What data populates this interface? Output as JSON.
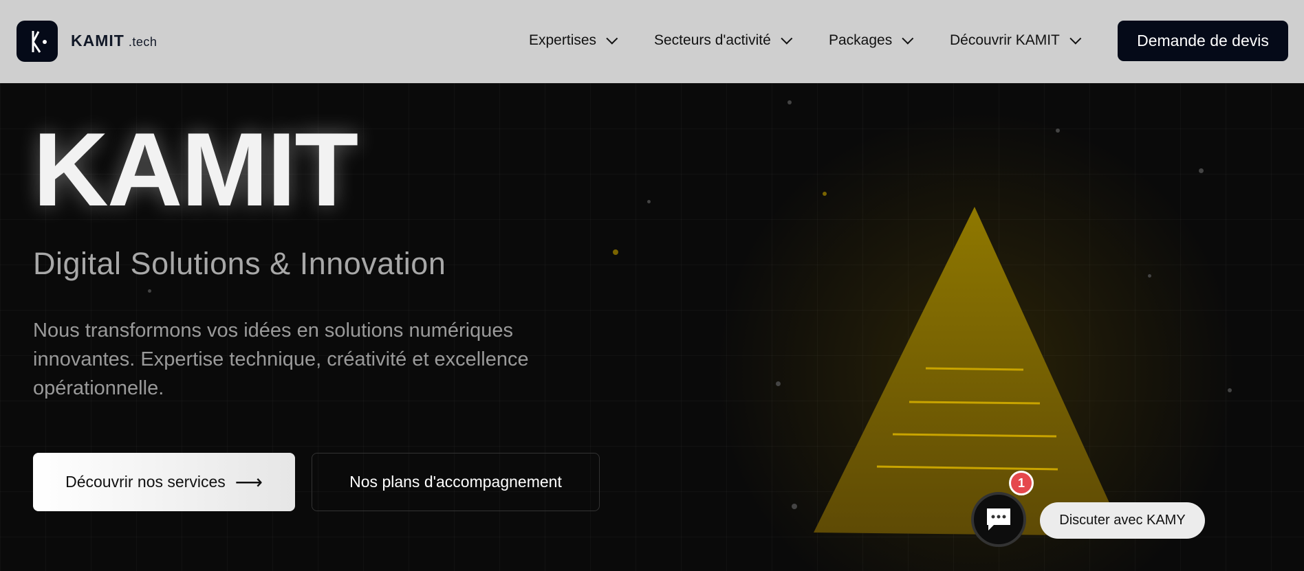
{
  "nav": {
    "brand": "KAMIT",
    "brand_suffix": ".tech",
    "items": [
      "Expertises",
      "Secteurs d'activité",
      "Packages",
      "Découvrir KAMIT"
    ],
    "cta": "Demande de devis"
  },
  "hero": {
    "title": "KAMIT",
    "subtitle": "Digital Solutions & Innovation",
    "description": "Nous transformons vos idées en solutions numériques innovantes. Expertise technique, créativité et excellence opérationnelle.",
    "primary_button": "Découvrir nos services",
    "primary_arrow": "⟶",
    "secondary_button": "Nos plans d'accompagnement"
  },
  "chat": {
    "badge_count": "1",
    "label": "Discuter avec KAMY"
  },
  "colors": {
    "accent": "#8a7200",
    "nav_bg": "#cfcfcf",
    "dark": "#050a18",
    "badge": "#e5484d"
  }
}
